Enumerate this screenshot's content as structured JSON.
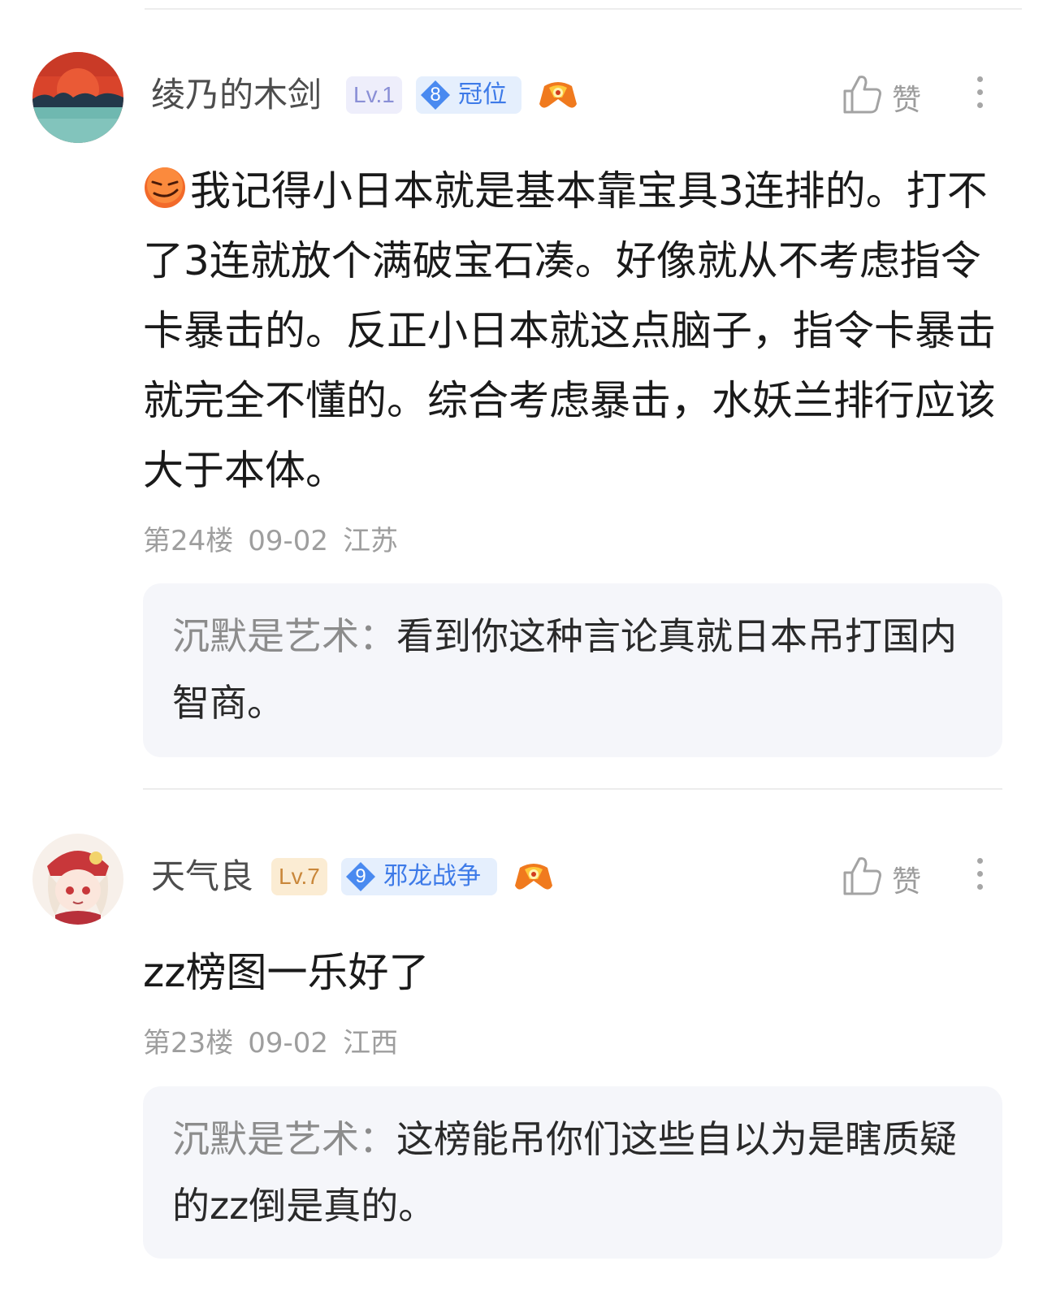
{
  "posts": [
    {
      "username": "绫乃的木剑",
      "level": "Lv.1",
      "rank_number": "8",
      "rank_title": "冠位",
      "like_label": "赞",
      "content": "我记得小日本就是基本靠宝具3连排的。打不了3连就放个满破宝石凑。好像就从不考虑指令卡暴击的。反正小日本就这点脑子，指令卡暴击就完全不懂的。综合考虑暴击，水妖兰排行应该大于本体。",
      "floor": "第24楼",
      "date": "09-02",
      "location": "江苏",
      "reply": {
        "author": "沉默是艺术：",
        "text": "看到你这种言论真就日本吊打国内智商。"
      }
    },
    {
      "username": "天气良",
      "level": "Lv.7",
      "rank_number": "9",
      "rank_title": "邪龙战争",
      "like_label": "赞",
      "content": "zz榜图一乐好了",
      "floor": "第23楼",
      "date": "09-02",
      "location": "江西",
      "reply": {
        "author": "沉默是艺术：",
        "text": "这榜能吊你们这些自以为是瞎质疑的zz倒是真的。"
      }
    }
  ],
  "colors": {
    "accent_blue": "#3d7ae8",
    "meta_gray": "#9e9e9e",
    "reply_bg": "#f5f6fa"
  },
  "icons": {
    "like": "thumbs-up-icon",
    "more": "more-vertical-icon",
    "game": "game-controller-icon",
    "emoji": "smirk-emoji-icon"
  }
}
